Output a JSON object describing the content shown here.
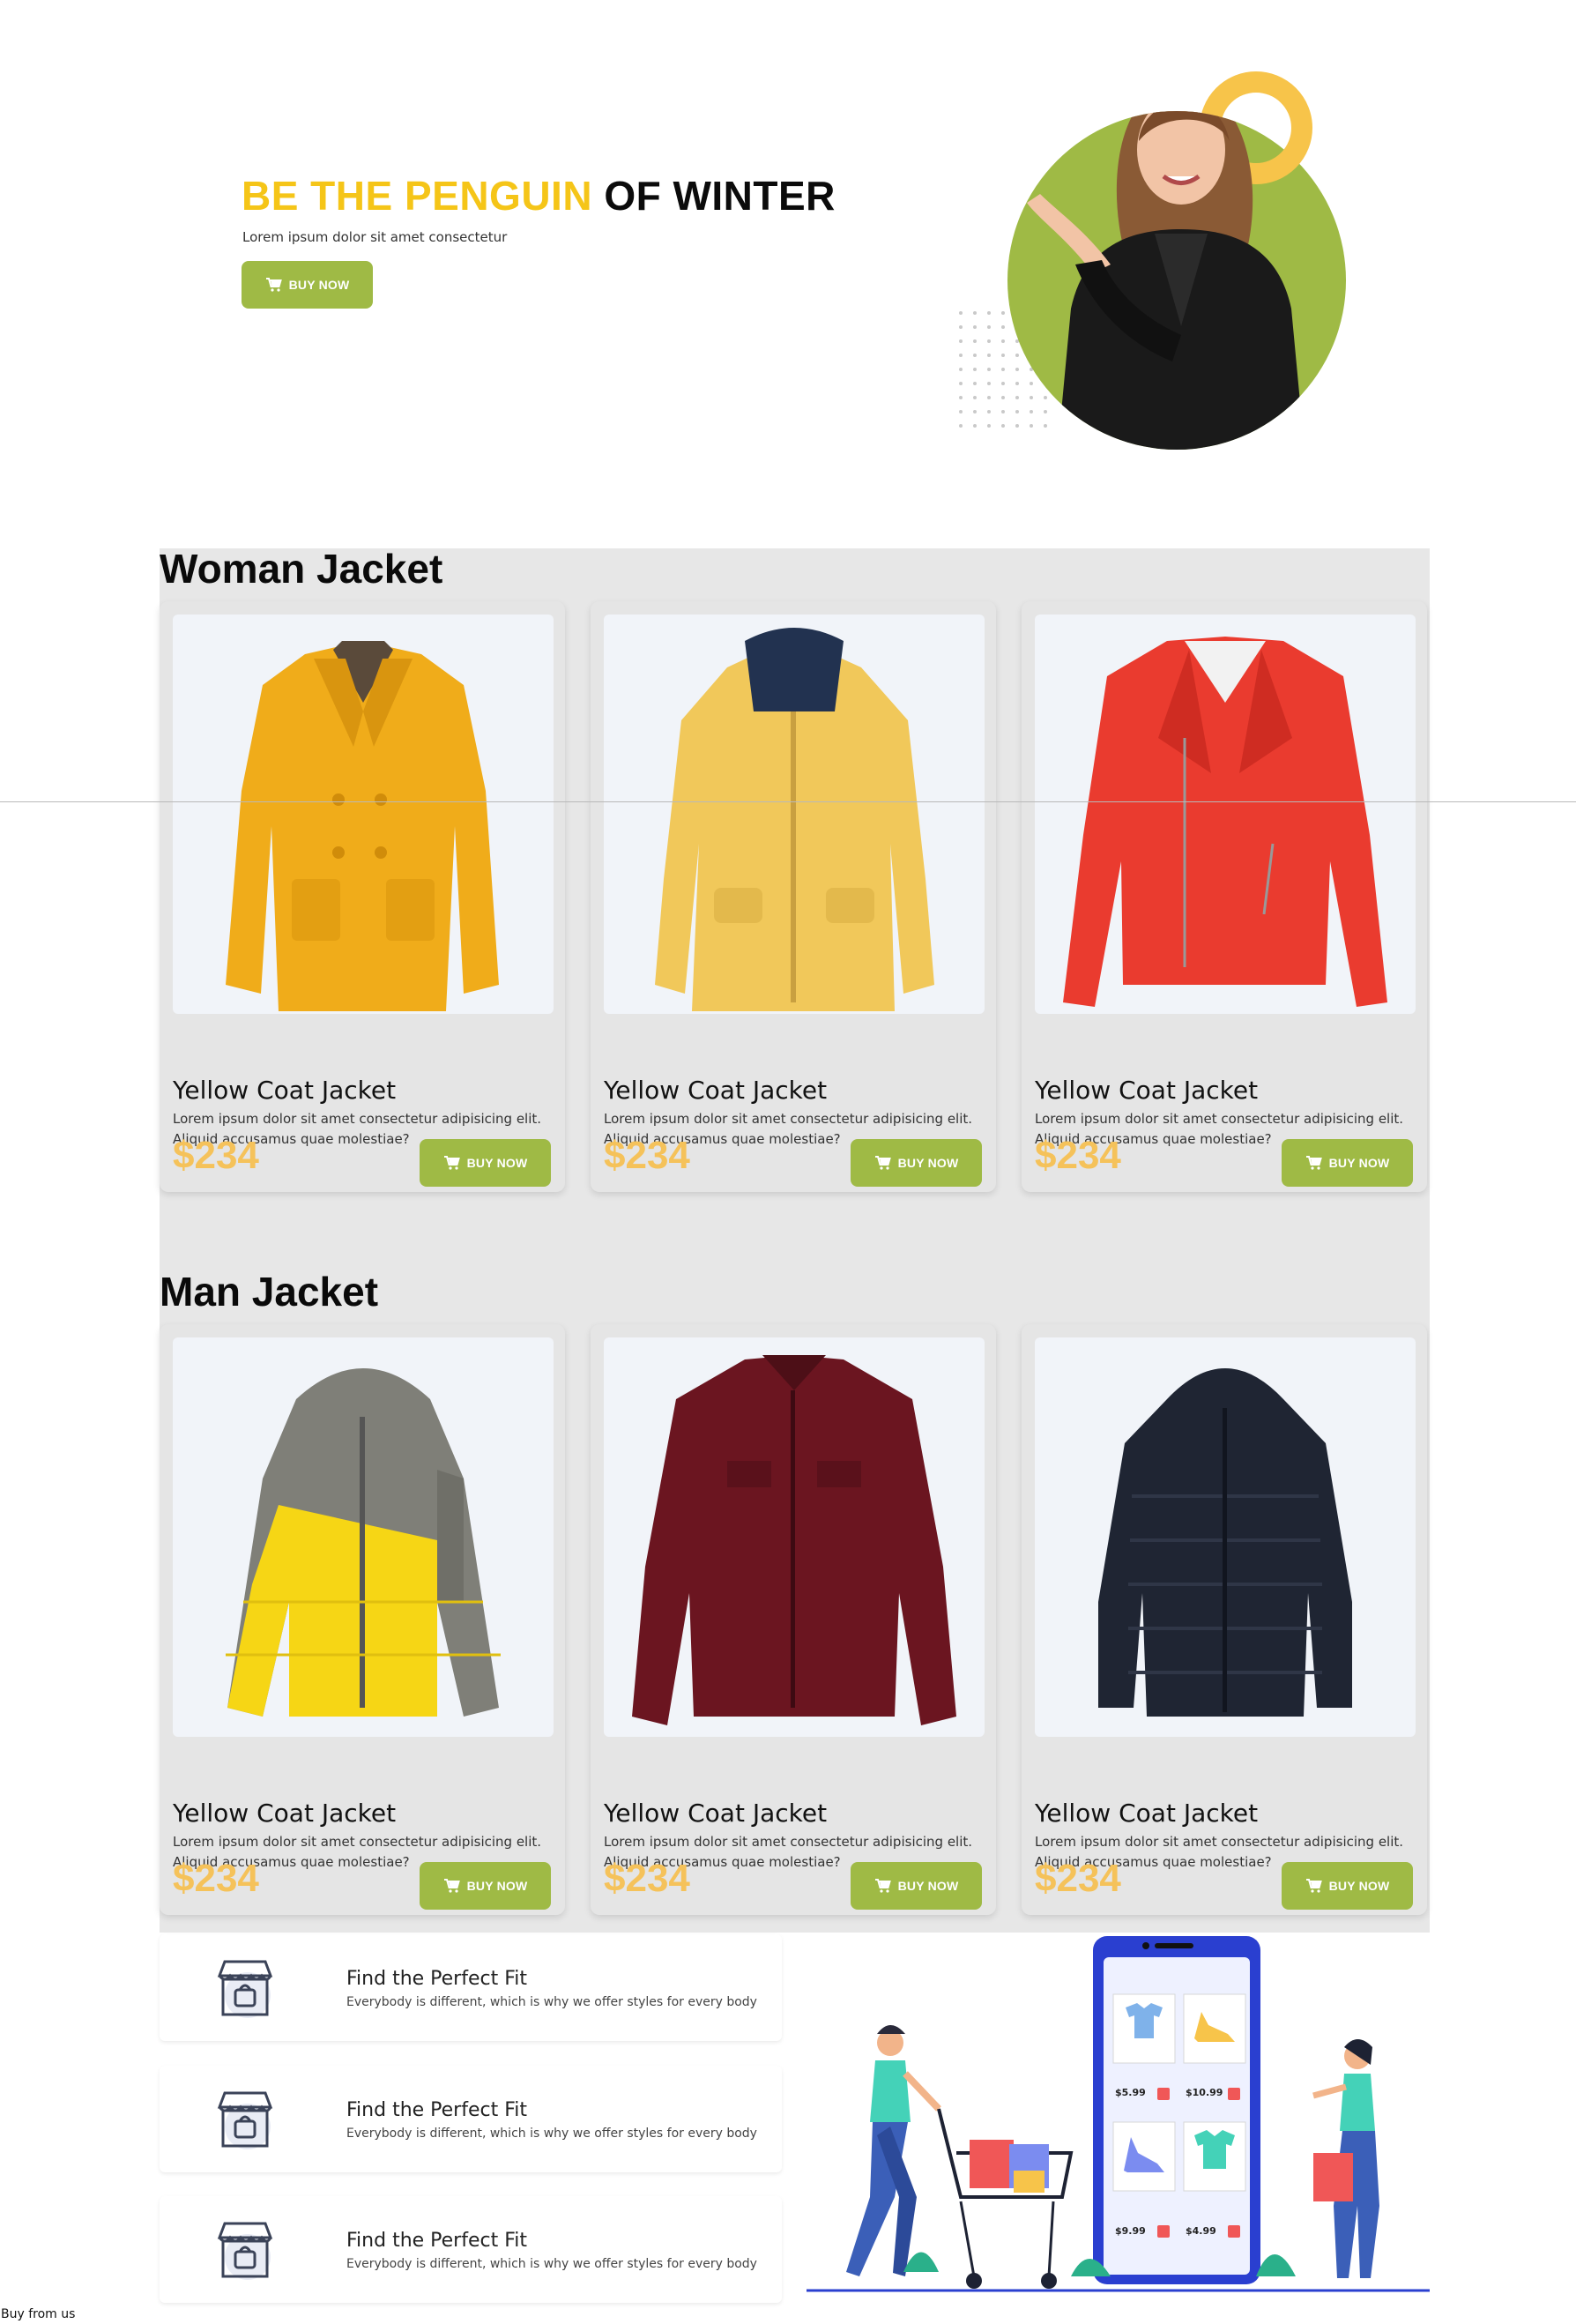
{
  "hero": {
    "title_accent": "BE THE PENGUIN",
    "title_rest": " OF WINTER",
    "subtitle": "Lorem ipsum dolor sit amet consectetur",
    "button_label": "BUY NOW"
  },
  "sections": {
    "woman_title": "Woman Jacket",
    "man_title": "Man Jacket"
  },
  "woman_products": [
    {
      "name": "Yellow Coat Jacket",
      "desc": "Lorem ipsum dolor sit amet consectetur adipisicing elit. Aliquid accusamus quae molestiae?",
      "price": "$234",
      "button": "BUY NOW"
    },
    {
      "name": "Yellow Coat Jacket",
      "desc": "Lorem ipsum dolor sit amet consectetur adipisicing elit. Aliquid accusamus quae molestiae?",
      "price": "$234",
      "button": "BUY NOW"
    },
    {
      "name": "Yellow Coat Jacket",
      "desc": "Lorem ipsum dolor sit amet consectetur adipisicing elit. Aliquid accusamus quae molestiae?",
      "price": "$234",
      "button": "BUY NOW"
    }
  ],
  "man_products": [
    {
      "name": "Yellow Coat Jacket",
      "desc": "Lorem ipsum dolor sit amet consectetur adipisicing elit. Aliquid accusamus quae molestiae?",
      "price": "$234",
      "button": "BUY NOW"
    },
    {
      "name": "Yellow Coat Jacket",
      "desc": "Lorem ipsum dolor sit amet consectetur adipisicing elit. Aliquid accusamus quae molestiae?",
      "price": "$234",
      "button": "BUY NOW"
    },
    {
      "name": "Yellow Coat Jacket",
      "desc": "Lorem ipsum dolor sit amet consectetur adipisicing elit. Aliquid accusamus quae molestiae?",
      "price": "$234",
      "button": "BUY NOW"
    }
  ],
  "features": [
    {
      "title": "Find the Perfect Fit",
      "desc": "Everybody is different, which is why we offer styles for every body"
    },
    {
      "title": "Find the Perfect Fit",
      "desc": "Everybody is different, which is why we offer styles for every body"
    },
    {
      "title": "Find the Perfect Fit",
      "desc": "Everybody is different, which is why we offer styles for every body"
    }
  ],
  "illustration": {
    "prices": [
      "$5.99",
      "$10.99",
      "$9.99",
      "$4.99"
    ]
  },
  "footer": {
    "text": "Buy from us"
  },
  "colors": {
    "accent_yellow": "#f5c518",
    "button_green": "#9fba45",
    "price_yellow": "#f5c25a",
    "section_bg": "#e7e7e7"
  }
}
